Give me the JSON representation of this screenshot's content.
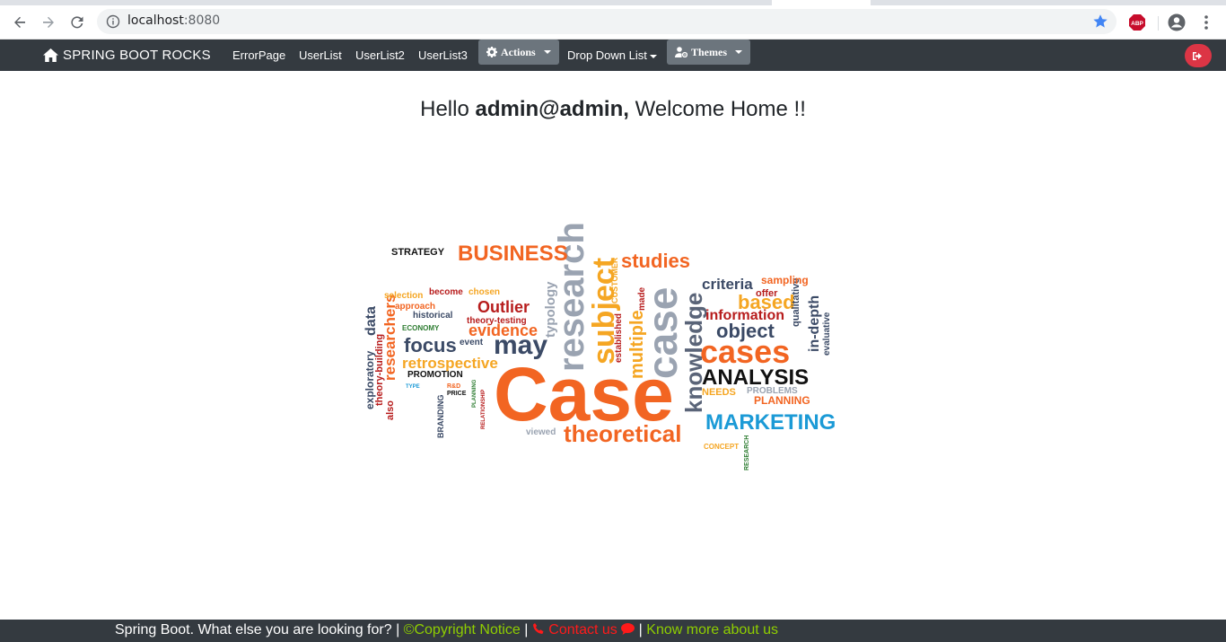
{
  "browser": {
    "url_host": "localhost",
    "url_port": ":8080",
    "abp_label": "ABP"
  },
  "navbar": {
    "brand": "SPRING BOOT ROCKS",
    "links": [
      "ErrorPage",
      "UserList",
      "UserList2",
      "UserList3"
    ],
    "actions_label": "Actions",
    "dropdown_label": "Drop Down List",
    "themes_label": "Themes"
  },
  "greeting": {
    "prefix": "Hello",
    "user": "admin@admin,",
    "suffix": "Welcome Home !!"
  },
  "wordcloud": {
    "words": [
      {
        "text": "Case",
        "color": "#f26522"
      },
      {
        "text": "research",
        "color": "#9aa3b1"
      },
      {
        "text": "case",
        "color": "#9aa3b1"
      },
      {
        "text": "subject",
        "color": "#f5a623"
      },
      {
        "text": "cases",
        "color": "#f26522"
      },
      {
        "text": "theoretical",
        "color": "#f26522"
      },
      {
        "text": "knowledge",
        "color": "#5a6478"
      },
      {
        "text": "MARKETING",
        "color": "#1b9ad6"
      },
      {
        "text": "BUSINESS",
        "color": "#f26522"
      },
      {
        "text": "ANALYSIS",
        "color": "#111111"
      },
      {
        "text": "studies",
        "color": "#f26522"
      },
      {
        "text": "may",
        "color": "#3b4a66"
      },
      {
        "text": "focus",
        "color": "#3b4a66"
      },
      {
        "text": "retrospective",
        "color": "#f5a623"
      },
      {
        "text": "evidence",
        "color": "#f26522"
      },
      {
        "text": "Outlier",
        "color": "#b71c1c"
      },
      {
        "text": "object",
        "color": "#3b4a66"
      },
      {
        "text": "based",
        "color": "#f5a623"
      },
      {
        "text": "information",
        "color": "#b71c1c"
      },
      {
        "text": "criteria",
        "color": "#3b4a66"
      },
      {
        "text": "multiple",
        "color": "#f5a623"
      },
      {
        "text": "typology",
        "color": "#9aa3b1"
      },
      {
        "text": "researchers",
        "color": "#f26522"
      },
      {
        "text": "data",
        "color": "#3b4a66"
      },
      {
        "text": "exploratory",
        "color": "#3b4a66"
      },
      {
        "text": "theory-building",
        "color": "#b71c1c"
      },
      {
        "text": "in-depth",
        "color": "#3b4a66"
      },
      {
        "text": "qualitative",
        "color": "#3b4a66"
      },
      {
        "text": "evaluative",
        "color": "#3b4a66"
      },
      {
        "text": "sampling",
        "color": "#f26522"
      },
      {
        "text": "offer",
        "color": "#b71c1c"
      },
      {
        "text": "PLANNING",
        "color": "#f26522"
      },
      {
        "text": "NEEDS",
        "color": "#f5a623"
      },
      {
        "text": "PROBLEMS",
        "color": "#9aa3b1"
      },
      {
        "text": "STRATEGY",
        "color": "#111111"
      },
      {
        "text": "PROMOTION",
        "color": "#111111"
      },
      {
        "text": "ECONOMY",
        "color": "#2e7d32"
      },
      {
        "text": "BRANDING",
        "color": "#3b4a66"
      },
      {
        "text": "CUSTOMER",
        "color": "#f5a623"
      },
      {
        "text": "theory-testing",
        "color": "#b71c1c"
      },
      {
        "text": "historical",
        "color": "#3b4a66"
      },
      {
        "text": "approach",
        "color": "#f26522"
      },
      {
        "text": "selection",
        "color": "#f5a623"
      },
      {
        "text": "become",
        "color": "#b71c1c"
      },
      {
        "text": "chosen",
        "color": "#f5a623"
      },
      {
        "text": "event",
        "color": "#3b4a66"
      },
      {
        "text": "established",
        "color": "#b71c1c"
      },
      {
        "text": "viewed",
        "color": "#9aa3b1"
      },
      {
        "text": "CONCEPT",
        "color": "#f5a623"
      },
      {
        "text": "RESEARCH",
        "color": "#2e7d32"
      },
      {
        "text": "also",
        "color": "#b71c1c"
      },
      {
        "text": "made",
        "color": "#b71c1c"
      },
      {
        "text": "RELATIONSHIP",
        "color": "#b71c1c"
      },
      {
        "text": "PLANNING",
        "color": "#2e7d32"
      },
      {
        "text": "PRICE",
        "color": "#111111"
      },
      {
        "text": "R&D",
        "color": "#f26522"
      },
      {
        "text": "TYPE",
        "color": "#1b9ad6"
      }
    ]
  },
  "footer": {
    "text1": "Spring Boot. What else you are looking for? |",
    "copyright_symbol": "©",
    "copyright": "Copyright Notice",
    "sep1": "|",
    "contact": "Contact us",
    "sep2": "|",
    "about": "Know more about us"
  }
}
